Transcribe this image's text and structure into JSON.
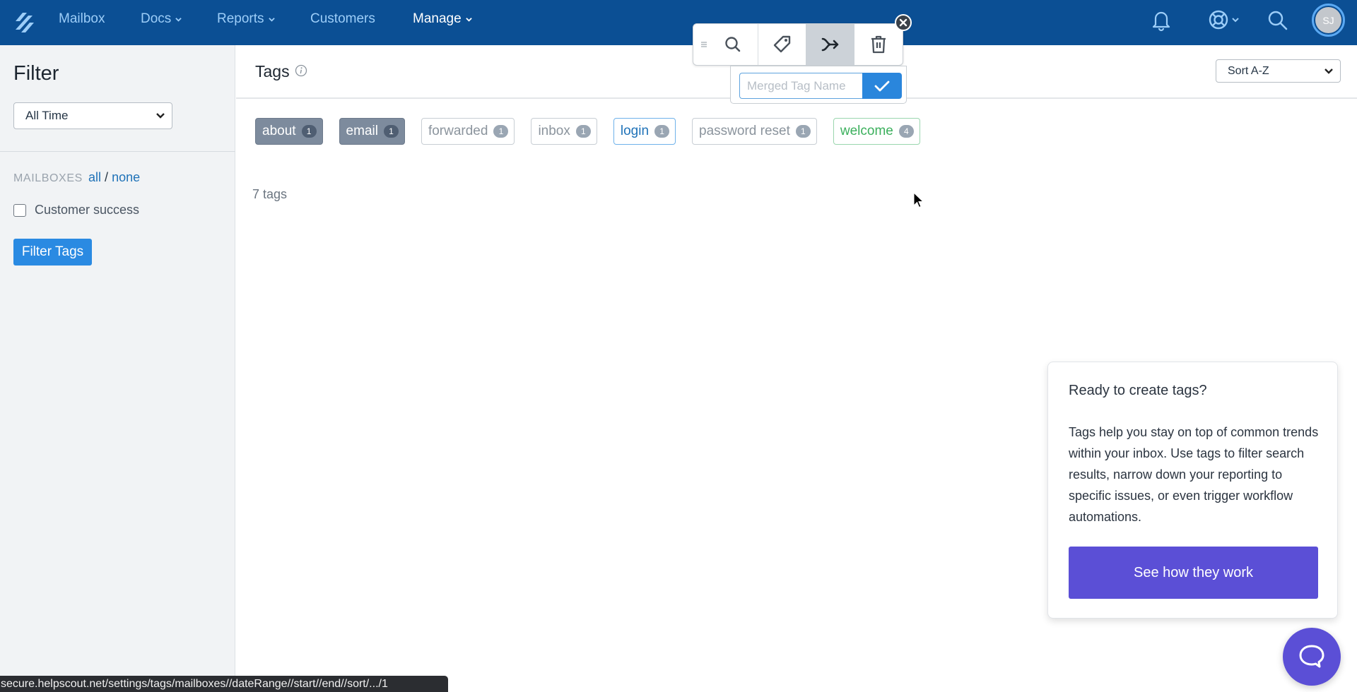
{
  "nav": {
    "logo": "helpscout-logo-icon",
    "items": [
      {
        "label": "Mailbox",
        "dropdown": false,
        "active": false
      },
      {
        "label": "Docs",
        "dropdown": true,
        "active": false
      },
      {
        "label": "Reports",
        "dropdown": true,
        "active": false
      },
      {
        "label": "Customers",
        "dropdown": false,
        "active": false
      },
      {
        "label": "Manage",
        "dropdown": true,
        "active": true
      }
    ],
    "right_icons": [
      "bell-icon",
      "lifebuoy-icon",
      "search-icon"
    ],
    "avatar_initials": "SJ"
  },
  "sidebar": {
    "title": "Filter",
    "date_range": {
      "selected": "All Time"
    },
    "mailboxes_label": "MAILBOXES",
    "all_link": "all",
    "separator": "/",
    "none_link": "none",
    "mailboxes": [
      {
        "label": "Customer success",
        "checked": false
      }
    ],
    "filter_button": "Filter Tags"
  },
  "main": {
    "title": "Tags",
    "sort": {
      "selected": "Sort A-Z"
    },
    "tags": [
      {
        "name": "about",
        "count": "1",
        "style": "dark"
      },
      {
        "name": "email",
        "count": "1",
        "style": "dark"
      },
      {
        "name": "forwarded",
        "count": "1",
        "style": "plain"
      },
      {
        "name": "inbox",
        "count": "1",
        "style": "plain"
      },
      {
        "name": "login",
        "count": "1",
        "style": "blue"
      },
      {
        "name": "password reset",
        "count": "1",
        "style": "plain"
      },
      {
        "name": "welcome",
        "count": "4",
        "style": "green"
      }
    ],
    "tag_count_text": "7 tags"
  },
  "toolbar": {
    "buttons": [
      "search-icon",
      "tag-icon",
      "merge-icon",
      "trash-icon"
    ],
    "active": "merge",
    "merge_input": {
      "value": "",
      "placeholder": "Merged Tag Name"
    }
  },
  "card": {
    "title": "Ready to create tags?",
    "body": "Tags help you stay on top of common trends within your inbox. Use tags to filter search results, narrow down your reporting to specific issues, or even trigger workflow automations.",
    "button": "See how they work"
  },
  "status_bar": {
    "url": "secure.helpscout.net/settings/tags/mailboxes//dateRange//start//end//sort/.../1"
  },
  "colors": {
    "nav_bg": "#0b4f94",
    "primary_blue": "#2a8ae2",
    "purple": "#5b4fd6"
  }
}
